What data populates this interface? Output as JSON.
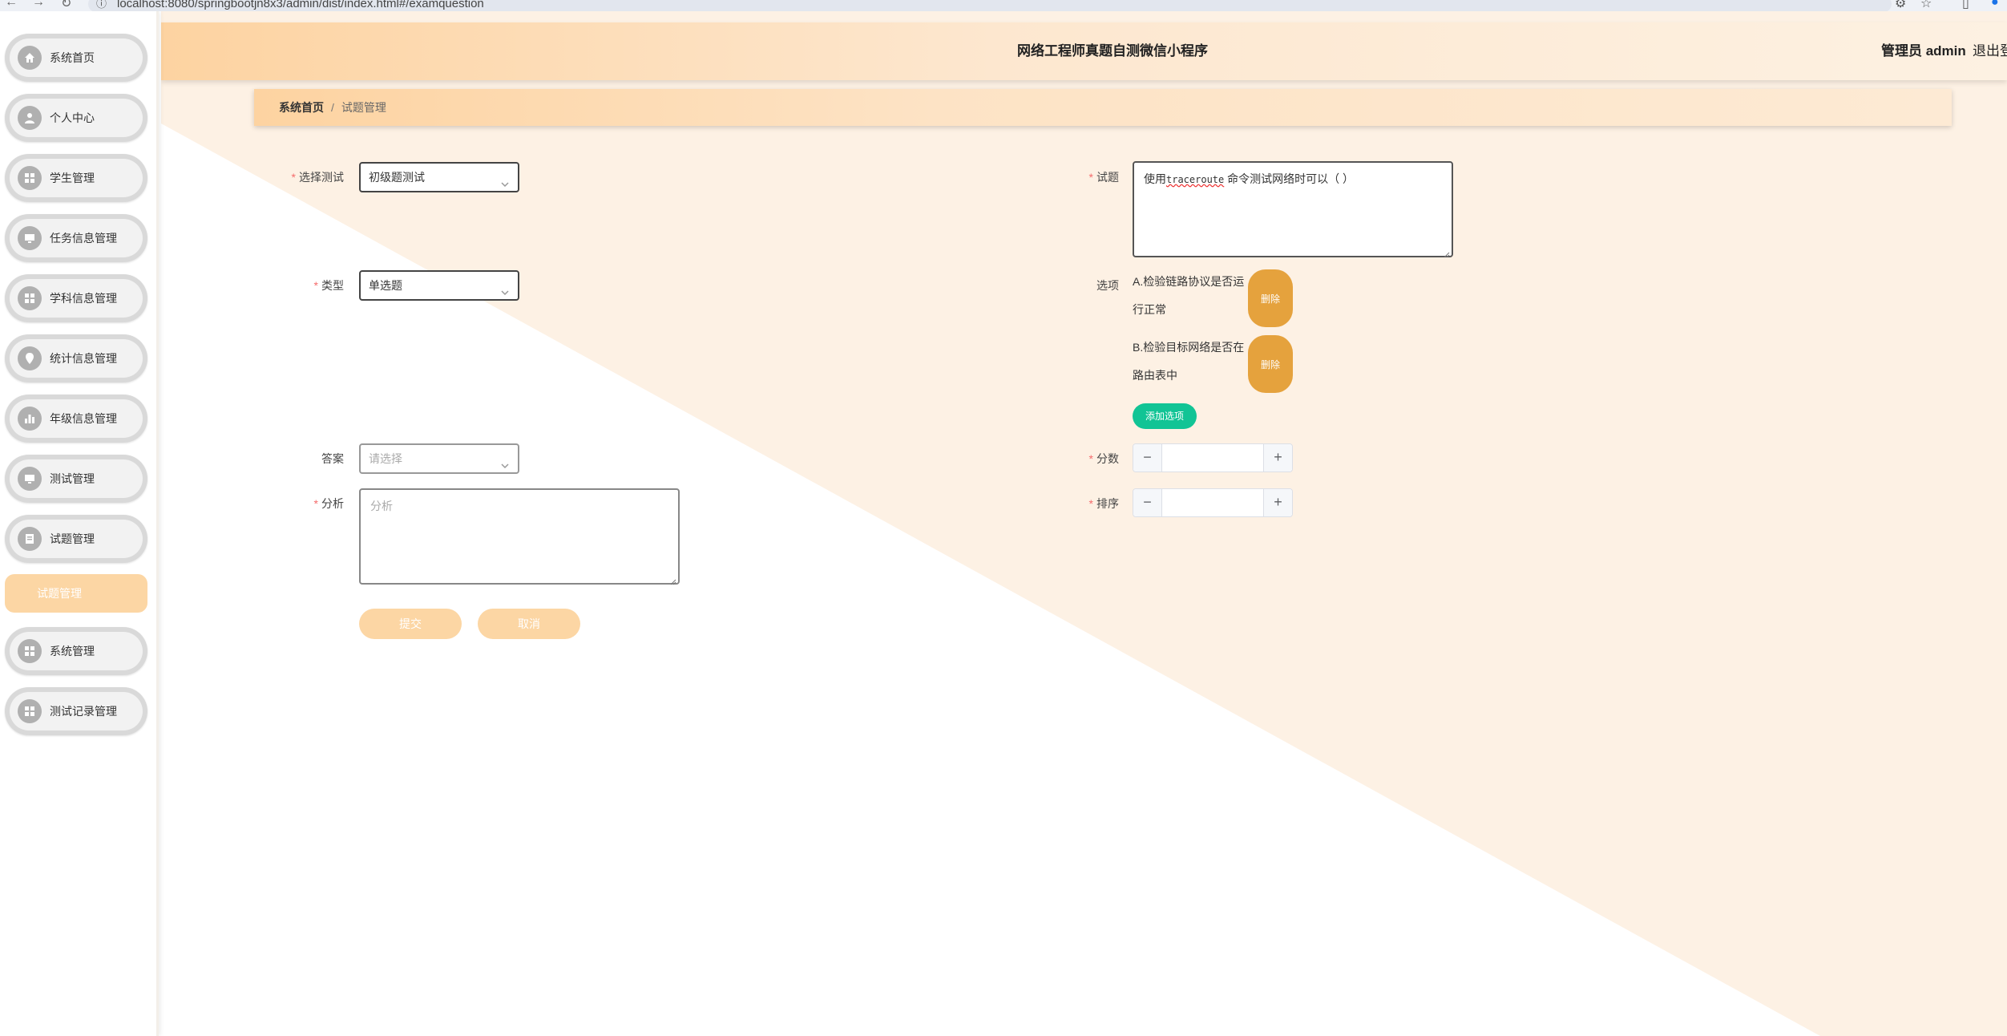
{
  "browser": {
    "url": "localhost:8080/springbootjn8x3/admin/dist/index.html#/examquestion",
    "back": "←",
    "forward": "→",
    "reload": "↻"
  },
  "header": {
    "title": "网络工程师真题自测微信小程序",
    "user": "管理员 admin",
    "logout": "退出登录"
  },
  "breadcrumb": {
    "home": "系统首页",
    "separator": "/",
    "current": "试题管理"
  },
  "sidebar": {
    "items": [
      {
        "label": "系统首页",
        "icon": "home-icon"
      },
      {
        "label": "个人中心",
        "icon": "user-icon"
      },
      {
        "label": "学生管理",
        "icon": "grid-icon"
      },
      {
        "label": "任务信息管理",
        "icon": "monitor-icon"
      },
      {
        "label": "学科信息管理",
        "icon": "grid-icon"
      },
      {
        "label": "统计信息管理",
        "icon": "location-icon"
      },
      {
        "label": "年级信息管理",
        "icon": "bar-chart-icon"
      },
      {
        "label": "测试管理",
        "icon": "monitor-icon"
      },
      {
        "label": "试题管理",
        "icon": "document-icon"
      },
      {
        "label": "系统管理",
        "icon": "grid-icon"
      },
      {
        "label": "测试记录管理",
        "icon": "grid-icon"
      }
    ],
    "submenu": {
      "label": "试题管理"
    }
  },
  "form": {
    "test": {
      "label": "选择测试",
      "required": true,
      "value": "初级题测试"
    },
    "question": {
      "label": "试题",
      "required": true,
      "prefix": "使用",
      "code": "traceroute",
      "suffix": " 命令测试网络时可以（ ）"
    },
    "type": {
      "label": "类型",
      "required": true,
      "value": "单选题"
    },
    "options": {
      "label": "选项",
      "items": [
        {
          "text": "A.检验链路协议是否运行正常",
          "delete": "删除"
        },
        {
          "text": "B.检验目标网络是否在路由表中",
          "delete": "删除"
        }
      ],
      "add_label": "添加选项"
    },
    "answer": {
      "label": "答案",
      "required": false,
      "placeholder": "请选择"
    },
    "score": {
      "label": "分数",
      "required": true,
      "value": ""
    },
    "analysis": {
      "label": "分析",
      "required": true,
      "placeholder": "分析"
    },
    "order": {
      "label": "排序",
      "required": true,
      "value": ""
    },
    "submit_label": "提交",
    "cancel_label": "取消"
  },
  "colors": {
    "accent": "#fcd6a4",
    "warning": "#e5a23d",
    "success": "#11c495",
    "required": "#f56c6c"
  }
}
